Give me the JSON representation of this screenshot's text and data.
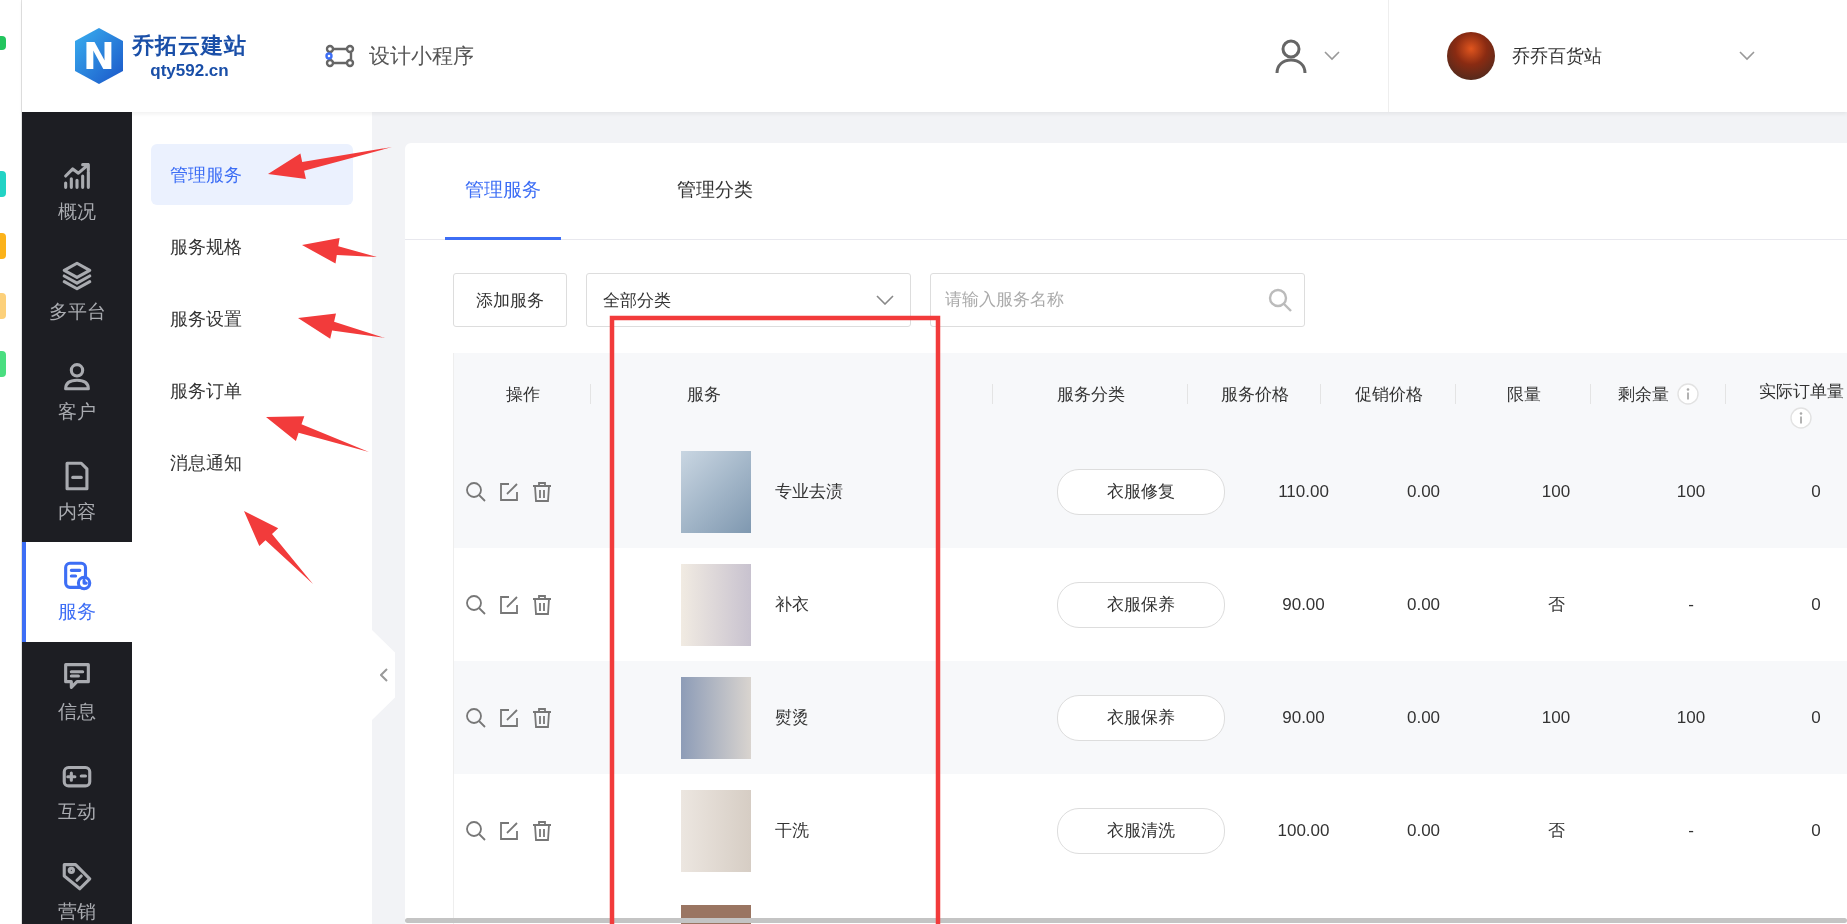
{
  "header": {
    "logo_mark": "N",
    "logo_title": "乔拓云建站",
    "logo_domain": "qty592.cn",
    "design_link": "设计小程序",
    "store_name": "乔乔百货站"
  },
  "sidebar": {
    "items": [
      {
        "label": "概况",
        "kind": "chart",
        "selected": false
      },
      {
        "label": "多平台",
        "kind": "layers",
        "selected": false
      },
      {
        "label": "客户",
        "kind": "user",
        "selected": false
      },
      {
        "label": "内容",
        "kind": "document",
        "selected": false
      },
      {
        "label": "服务",
        "kind": "service",
        "selected": true
      },
      {
        "label": "信息",
        "kind": "message",
        "selected": false
      },
      {
        "label": "互动",
        "kind": "game",
        "selected": false
      },
      {
        "label": "营销",
        "kind": "tag",
        "selected": false
      }
    ]
  },
  "submenu": {
    "items": [
      {
        "label": "管理服务",
        "selected": true
      },
      {
        "label": "服务规格",
        "selected": false
      },
      {
        "label": "服务设置",
        "selected": false
      },
      {
        "label": "服务订单",
        "selected": false
      },
      {
        "label": "消息通知",
        "selected": false
      }
    ]
  },
  "tabs": [
    {
      "label": "管理服务",
      "selected": true
    },
    {
      "label": "管理分类",
      "selected": false
    }
  ],
  "toolbar": {
    "add_button": "添加服务",
    "category_select": "全部分类",
    "search": {
      "placeholder": "请输入服务名称"
    }
  },
  "table": {
    "columns": [
      {
        "label": "操作",
        "info": false
      },
      {
        "label": "服务",
        "info": false
      },
      {
        "label": "服务分类",
        "info": false
      },
      {
        "label": "服务价格",
        "info": false
      },
      {
        "label": "促销价格",
        "info": false
      },
      {
        "label": "限量",
        "info": false
      },
      {
        "label": "剩余量",
        "info": true
      },
      {
        "label": "实际订单量",
        "info": true
      }
    ],
    "rows": [
      {
        "name": "专业去渍",
        "category": "衣服修复",
        "price": "110.00",
        "promo_price": "0.00",
        "limit": "100",
        "remaining": "100",
        "orders": "0"
      },
      {
        "name": "补衣",
        "category": "衣服保养",
        "price": "90.00",
        "promo_price": "0.00",
        "limit": "否",
        "remaining": "-",
        "orders": "0"
      },
      {
        "name": "熨烫",
        "category": "衣服保养",
        "price": "90.00",
        "promo_price": "0.00",
        "limit": "100",
        "remaining": "100",
        "orders": "0"
      },
      {
        "name": "干洗",
        "category": "衣服清洗",
        "price": "100.00",
        "promo_price": "0.00",
        "limit": "否",
        "remaining": "-",
        "orders": "0"
      }
    ]
  }
}
